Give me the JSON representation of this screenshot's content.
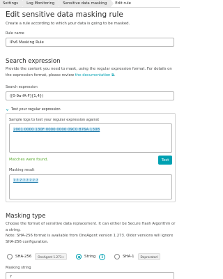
{
  "breadcrumb": [
    "Settings",
    "Log Monitoring",
    "Sensitive data masking",
    "Edit rule"
  ],
  "page": {
    "title": "Edit sensitive data masking rule",
    "description": "Create a rule according to which your data is going to be masked."
  },
  "rule_name": {
    "label": "Rule name",
    "value": "IPv6 Masking Rule"
  },
  "search_expression": {
    "section_title": "Search expression",
    "description_pre": "Provide the content you need to mask, using the regular expression format. For details on the expression format, please review ",
    "link_text": "the documentation",
    "description_post": ".",
    "field_label": "Search expression",
    "value": "([0-9a-fA-F]{1,4})"
  },
  "test": {
    "expander_label": "Test your regular expression",
    "sample_label": "Sample logs to test your regular expression against",
    "sample_value": "2001 0000 130F 0000 0000 09C0 876A 130B",
    "status": "Matches were found.",
    "button": "Test",
    "result_label": "Masking result",
    "result_value": "? ? ? ? ? ? ? ?"
  },
  "masking_type": {
    "section_title": "Masking type",
    "description": "Choose the format of sensitive data replacement. It can either be Secure Hash Algorithm or a string.",
    "note": "Note: SHA-256 format is available from OneAgent version 1.273. Older versions will ignore SHA-256 configuration.",
    "options": [
      {
        "label": "SHA-256",
        "badge": "OneAgent 1.273+",
        "selected": false
      },
      {
        "label": "String",
        "badge": "",
        "selected": true
      },
      {
        "label": "SHA-1",
        "badge": "Deprecated",
        "selected": false
      }
    ],
    "info_icon_glyph": "i"
  },
  "masking_string": {
    "label": "Masking string",
    "value": "?"
  },
  "colors": {
    "accent": "#00a1b2",
    "success": "#5ead35",
    "highlight": "#c8e6f4"
  }
}
